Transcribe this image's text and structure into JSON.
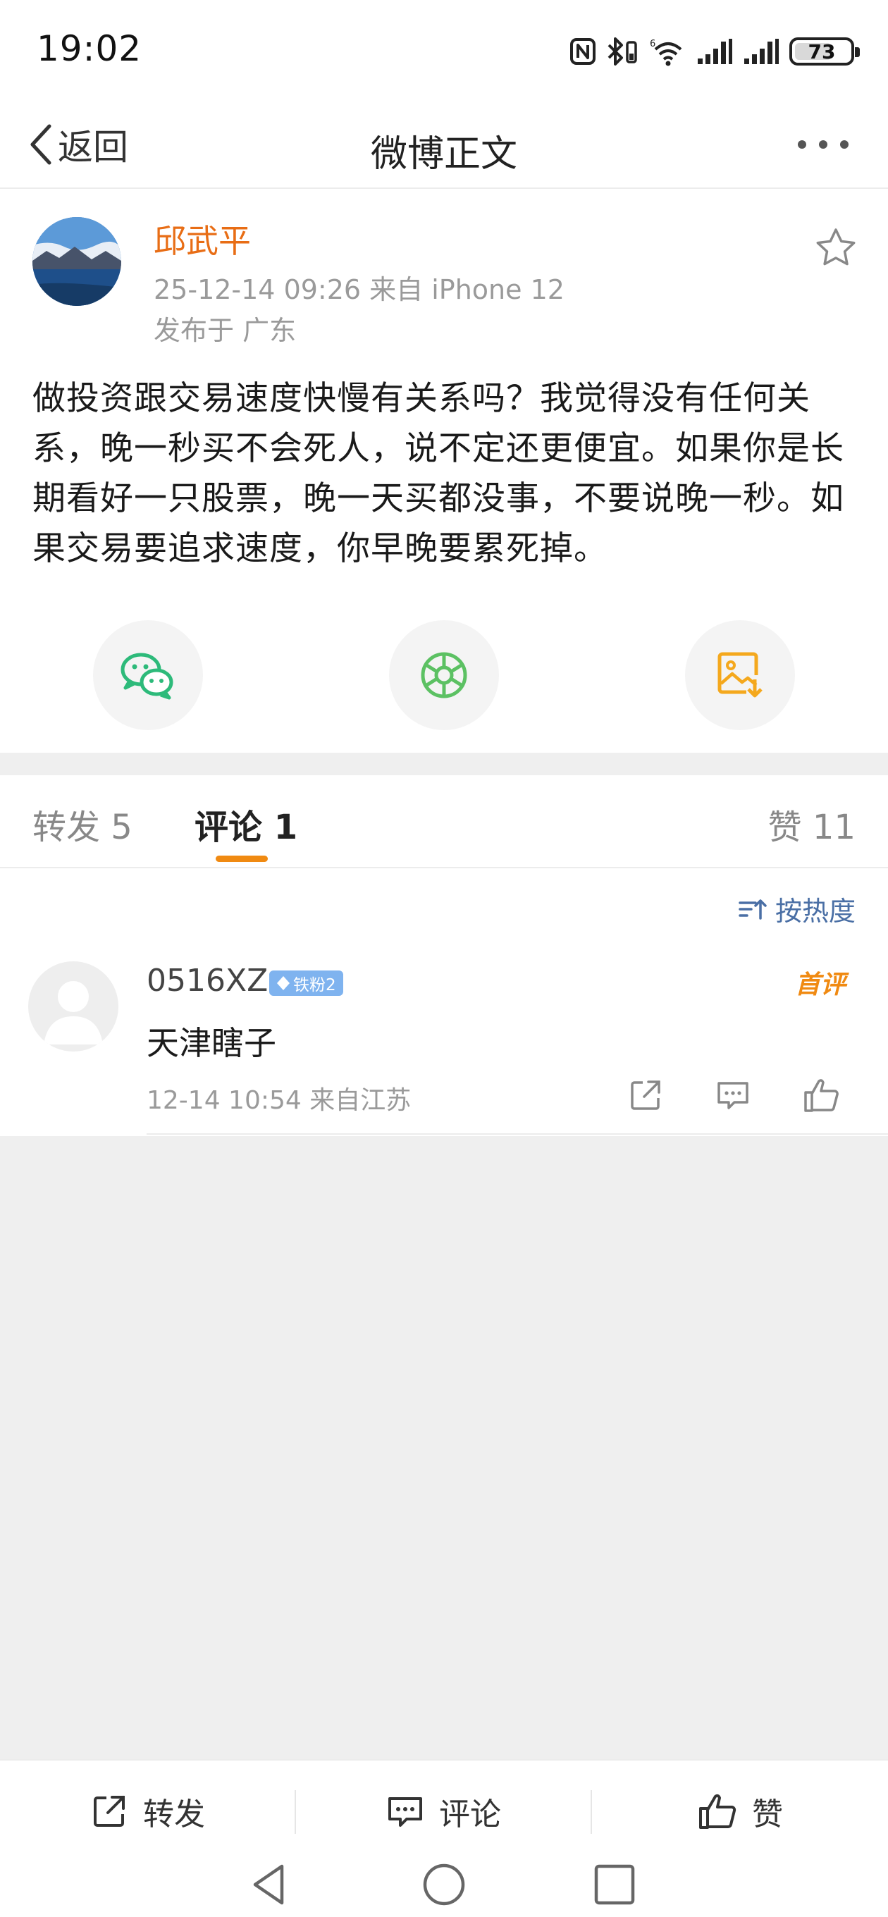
{
  "status_bar": {
    "time": "19:02",
    "battery": "73"
  },
  "nav": {
    "back_label": "返回",
    "title": "微博正文"
  },
  "post": {
    "author": "邱武平",
    "meta": "25-12-14 09:26  来自 iPhone 12",
    "location": "发布于 广东",
    "text": "做投资跟交易速度快慢有关系吗？我觉得没有任何关系，晚一秒买不会死人，说不定还更便宜。如果你是长期看好一只股票，晚一天买都没事，不要说晚一秒。如果交易要追求速度，你早晚要累死掉。",
    "share_icons": [
      "wechat-icon",
      "moments-icon",
      "save-image-icon"
    ]
  },
  "tabs": {
    "repost": "转发 5",
    "comment": "评论 1",
    "like": "赞 11"
  },
  "comments": {
    "sort_label": "按热度",
    "items": [
      {
        "user": "0516XZ",
        "badge": "铁粉2",
        "first_badge": "首评",
        "text": "天津瞎子",
        "meta": "12-14 10:54 来自江苏"
      }
    ]
  },
  "bottom_bar": {
    "repost": "转发",
    "comment": "评论",
    "like": "赞"
  },
  "colors": {
    "accent": "#f08a12",
    "author": "#e86d15",
    "link": "#4a6fa5",
    "wechat": "#2dba7a",
    "moments": "#5cc163",
    "save": "#f4a81d"
  }
}
